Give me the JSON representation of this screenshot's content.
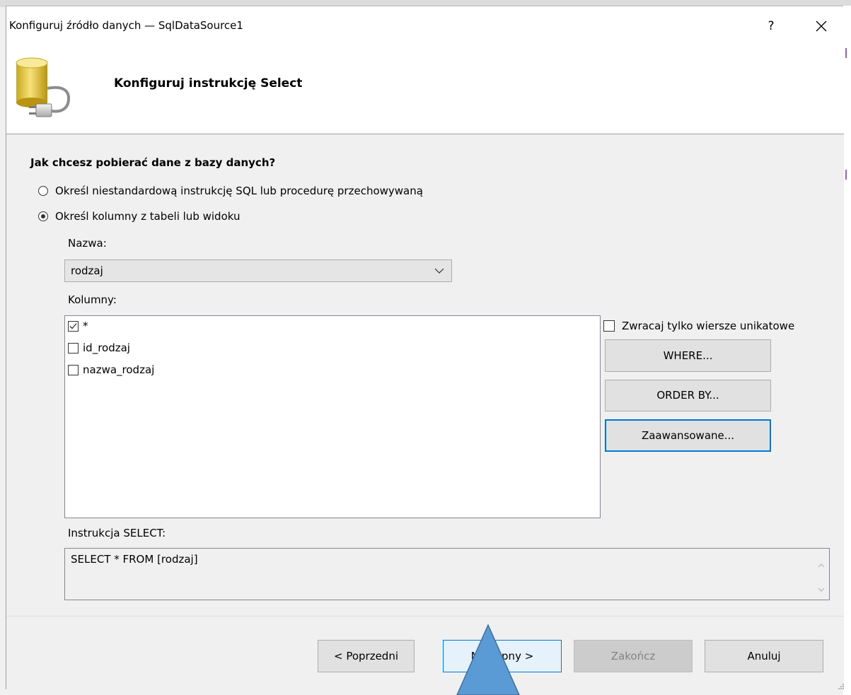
{
  "window": {
    "title": "Konfiguruj źródło danych — SqlDataSource1",
    "help_label": "?",
    "close_label": "×"
  },
  "header": {
    "heading": "Konfiguruj instrukcję Select",
    "icon": "database-plug-icon"
  },
  "question": "Jak chcesz pobierać dane z bazy danych?",
  "options": {
    "custom_sql": {
      "label": "Określ niestandardową instrukcję SQL lub procedurę przechowywaną",
      "checked": false
    },
    "columns": {
      "label": "Określ kolumny z tabeli lub widoku",
      "checked": true
    }
  },
  "name_field": {
    "label": "Nazwa:",
    "value": "rodzaj"
  },
  "columns_field": {
    "label": "Kolumny:",
    "items": [
      {
        "name": "*",
        "checked": true
      },
      {
        "name": "id_rodzaj",
        "checked": false
      },
      {
        "name": "nazwa_rodzaj",
        "checked": false
      }
    ]
  },
  "unique_rows": {
    "label": "Zwracaj tylko wiersze unikatowe",
    "checked": false
  },
  "side_buttons": {
    "where": "WHERE...",
    "order_by": "ORDER BY...",
    "advanced": "Zaawansowane..."
  },
  "select_statement": {
    "label": "Instrukcja SELECT:",
    "value": "SELECT * FROM [rodzaj]"
  },
  "footer": {
    "previous": "< Poprzedni",
    "next": "Następny >",
    "finish": "Zakończ",
    "cancel": "Anuluj"
  },
  "colors": {
    "accent": "#0078d7",
    "dialog_bg": "#f0f0f0",
    "tooltip_arrow": "#5b9bd5"
  }
}
